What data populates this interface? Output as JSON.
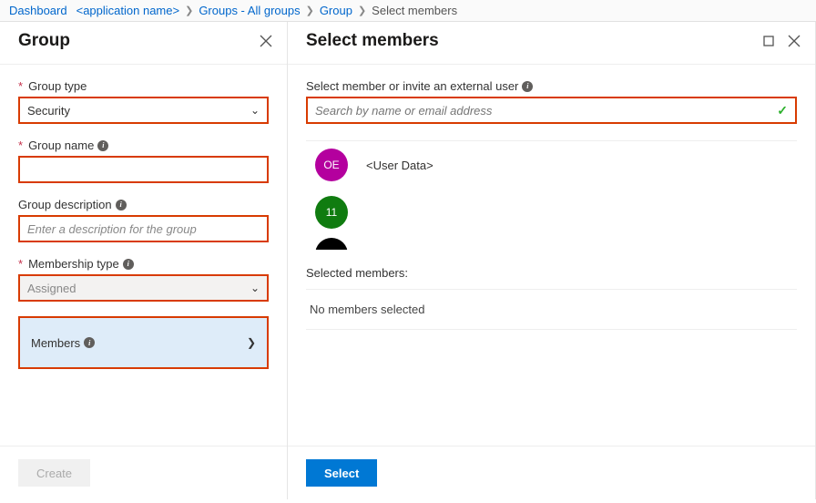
{
  "breadcrumb": {
    "dashboard": "Dashboard",
    "app_name": "<application name>",
    "groups": "Groups - All groups",
    "group": "Group",
    "current": "Select members"
  },
  "left": {
    "title": "Group",
    "group_type_label": "Group type",
    "group_type_value": "Security",
    "group_name_label": "Group name",
    "group_name_value": "",
    "group_desc_label": "Group description",
    "group_desc_placeholder": "Enter a description for the group",
    "membership_type_label": "Membership type",
    "membership_type_value": "Assigned",
    "members_label": "Members",
    "create_btn": "Create"
  },
  "right": {
    "title": "Select members",
    "search_label": "Select member or invite an external user",
    "search_placeholder": "Search by name or email address",
    "results": {
      "r0": {
        "initials": "OE",
        "name": "<User Data>"
      },
      "r1": {
        "initials": "11",
        "name": ""
      }
    },
    "selected_label": "Selected members:",
    "no_members": "No members selected",
    "select_btn": "Select"
  }
}
